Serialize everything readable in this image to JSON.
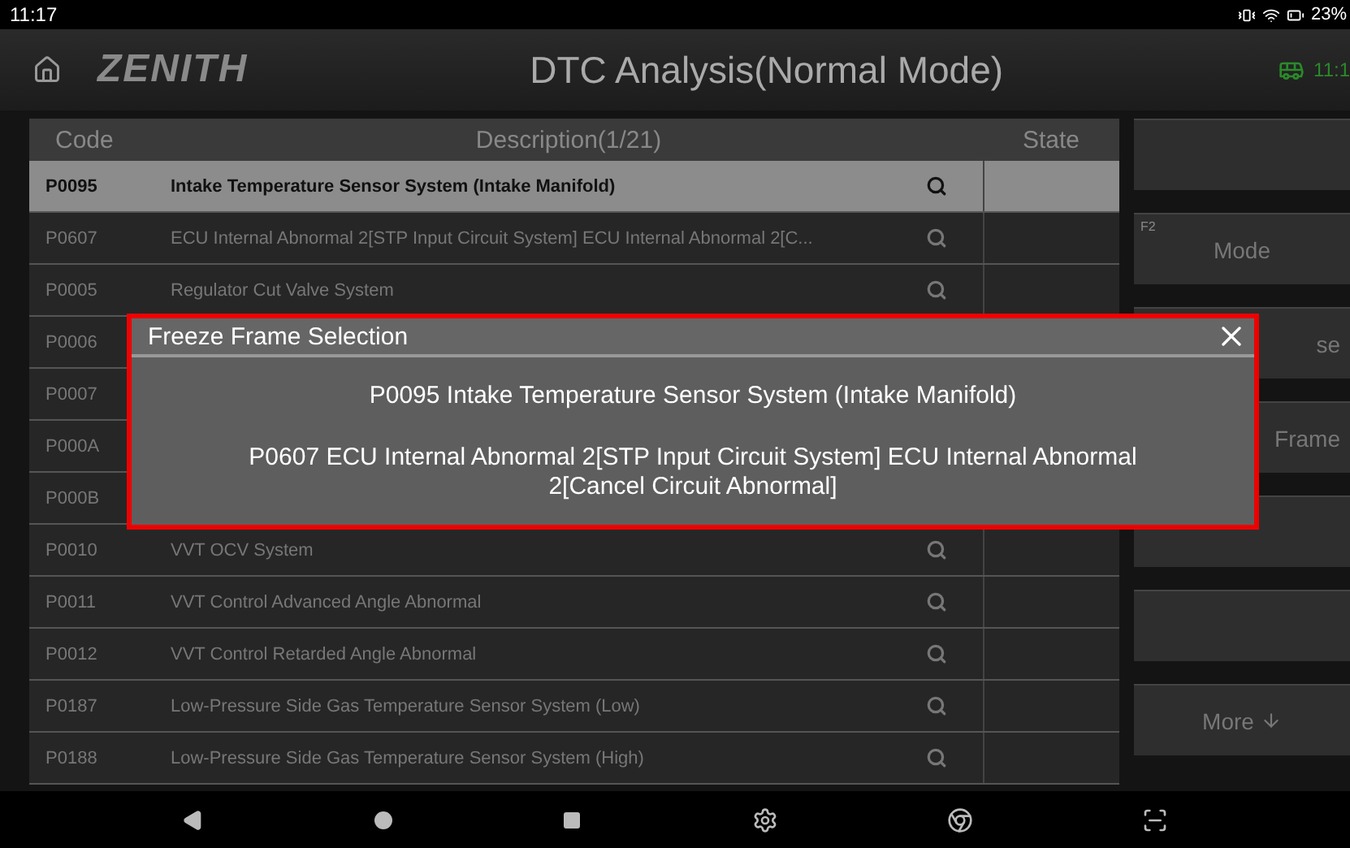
{
  "status_bar": {
    "time": "11:17",
    "battery": "23%"
  },
  "header": {
    "title": "DTC Analysis(Normal Mode)",
    "logo": "ZENITH",
    "clock": "11:1"
  },
  "table": {
    "columns": [
      "Code",
      "Description(1/21)",
      "State"
    ],
    "rows": [
      {
        "code": "P0095",
        "description": "Intake Temperature Sensor System (Intake Manifold)",
        "selected": true
      },
      {
        "code": "P0607",
        "description": "ECU Internal Abnormal 2[STP Input Circuit System] ECU Internal Abnormal 2[C...",
        "selected": false
      },
      {
        "code": "P0005",
        "description": "Regulator Cut Valve System",
        "selected": false
      },
      {
        "code": "P0006",
        "selected": false
      },
      {
        "code": "P0007",
        "selected": false
      },
      {
        "code": "P000A",
        "selected": false
      },
      {
        "code": "P000B",
        "selected": false
      },
      {
        "code": "P0010",
        "description": "VVT OCV System",
        "selected": false
      },
      {
        "code": "P0011",
        "description": "VVT Control Advanced Angle Abnormal",
        "selected": false
      },
      {
        "code": "P0012",
        "description": "VVT Control Retarded Angle Abnormal",
        "selected": false
      },
      {
        "code": "P0187",
        "description": "Low-Pressure Side Gas Temperature Sensor System (Low)",
        "selected": false
      },
      {
        "code": "P0188",
        "description": "Low-Pressure Side Gas Temperature Sensor System (High)",
        "selected": false
      }
    ]
  },
  "side_buttons": [
    {
      "kind": "blank"
    },
    {
      "kind": "key",
      "label": "Mode",
      "key": "F2"
    },
    {
      "kind": "covered",
      "label": "se"
    },
    {
      "kind": "covered",
      "label": "Frame"
    },
    {
      "kind": "blank"
    },
    {
      "kind": "blank"
    },
    {
      "kind": "more",
      "label": "More"
    }
  ],
  "dialog": {
    "title": "Freeze Frame Selection",
    "options": [
      "P0095 Intake Temperature Sensor System (Intake Manifold)",
      "P0607 ECU Internal Abnormal 2[STP Input Circuit System] ECU Internal Abnormal 2[Cancel Circuit Abnormal]"
    ]
  }
}
